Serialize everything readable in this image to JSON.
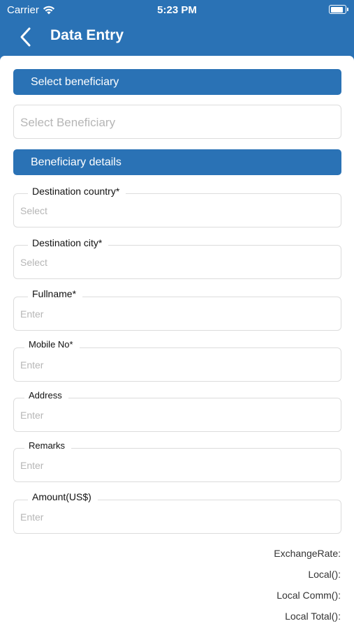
{
  "status_bar": {
    "carrier": "Carrier",
    "time": "5:23 PM",
    "battery_level": 0.9
  },
  "nav": {
    "title": "Data Entry",
    "back_icon": "chevron-left-icon"
  },
  "sections": {
    "select_beneficiary": "Select beneficiary",
    "beneficiary_details": "Beneficiary details"
  },
  "beneficiary_picker": {
    "placeholder": "Select Beneficiary"
  },
  "fields": {
    "destination_country": {
      "label": "Destination country*",
      "placeholder": "Select"
    },
    "destination_city": {
      "label": "Destination city*",
      "placeholder": "Select"
    },
    "fullname": {
      "label": "Fullname*",
      "placeholder": "Enter"
    },
    "mobile_no": {
      "label": "Mobile No*",
      "placeholder": "Enter"
    },
    "address": {
      "label": "Address",
      "placeholder": "Enter"
    },
    "remarks": {
      "label": "Remarks",
      "placeholder": "Enter"
    },
    "amount": {
      "label": "Amount(US$)",
      "placeholder": "Enter"
    }
  },
  "summary": {
    "exchange_rate": "ExchangeRate:",
    "local": "Local():",
    "local_comm": "Local Comm():",
    "local_total": "Local Total():"
  },
  "colors": {
    "primary": "#2a72b5",
    "border": "#dcdcdc",
    "placeholder": "#b6b6b6"
  }
}
